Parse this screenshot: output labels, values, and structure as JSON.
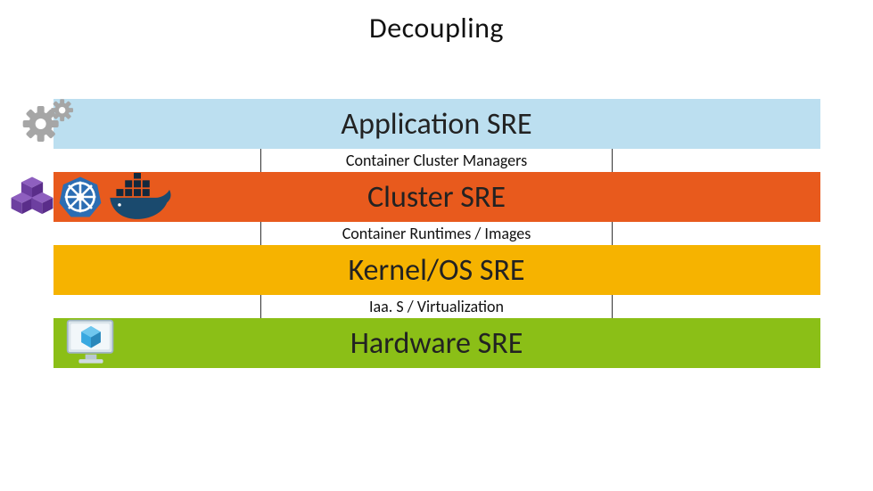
{
  "title": "Decoupling",
  "layers": {
    "application": {
      "label": "Application SRE"
    },
    "cluster": {
      "label": "Cluster SRE"
    },
    "kernel": {
      "label": "Kernel/OS SRE"
    },
    "hardware": {
      "label": "Hardware SRE"
    }
  },
  "sublayers": {
    "cluster_managers": "Container Cluster Managers",
    "container_runtimes": "Container Runtimes / Images",
    "iaas": "Iaa. S / Virtualization"
  },
  "colors": {
    "application": "#bcdff0",
    "cluster": "#e85a1d",
    "kernel": "#f6b300",
    "hardware": "#8bbf17"
  },
  "icons": {
    "gears": "gear-cluster-icon",
    "mesos": "cubes-icon",
    "kubernetes": "ship-wheel-icon",
    "docker": "whale-icon",
    "hardware": "monitor-cube-icon"
  }
}
